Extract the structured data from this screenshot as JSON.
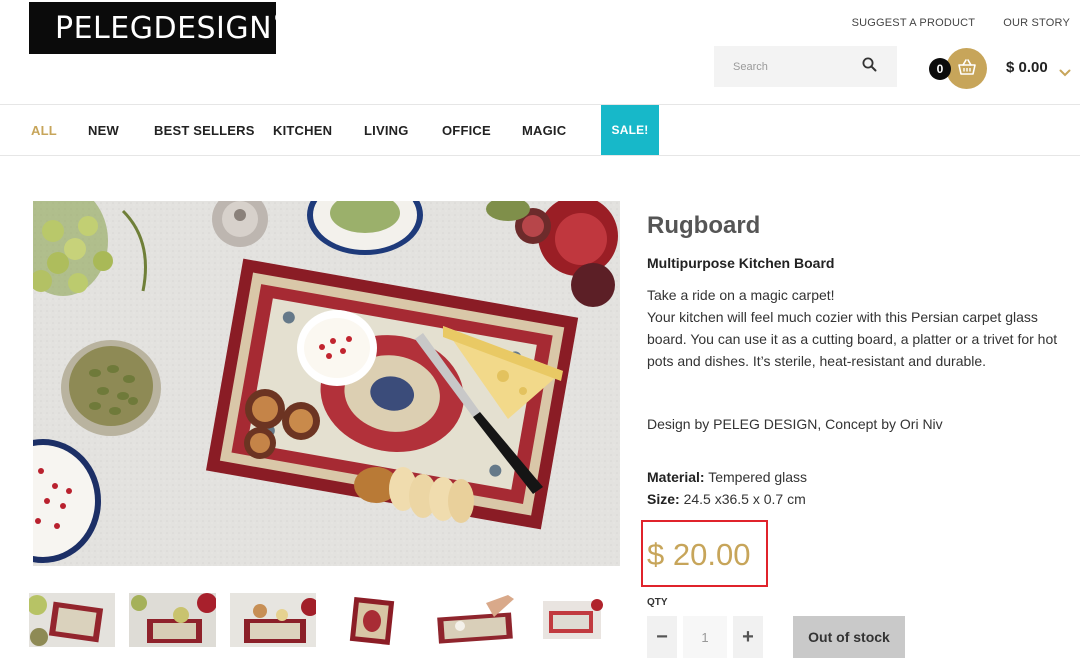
{
  "header": {
    "logo_text": "PELEGDESIGN",
    "logo_mark": "®",
    "top_links": [
      "SUGGEST A PRODUCT",
      "OUR STORY"
    ],
    "search_placeholder": "Search",
    "cart_count": "0",
    "cart_total": "$ 0.00"
  },
  "nav": {
    "items": [
      {
        "label": "ALL",
        "active": true
      },
      {
        "label": "NEW"
      },
      {
        "label": "BEST SELLERS"
      },
      {
        "label": "KITCHEN"
      },
      {
        "label": "LIVING"
      },
      {
        "label": "OFFICE"
      },
      {
        "label": "MAGIC"
      },
      {
        "label": "SALE!"
      }
    ]
  },
  "product": {
    "title": "Rugboard",
    "subtitle": "Multipurpose Kitchen Board",
    "description": [
      "Take a ride on a magic carpet!",
      "Your kitchen will feel much cozier with this Persian carpet glass board. You can use it as a cutting board, a platter or a trivet for hot pots and dishes. It’s sterile, heat-resistant and durable."
    ],
    "credit": "Design by PELEG DESIGN, Concept by Ori Niv",
    "material_label": "Material:",
    "material_value": "Tempered glass",
    "size_label": "Size:",
    "size_value": "24.5 x36.5 x 0.7 cm",
    "price": "$ 20.00",
    "qty_label": "QTY",
    "qty_minus": "−",
    "qty_value": "1",
    "qty_plus": "+",
    "stock_button": "Out of stock"
  },
  "colors": {
    "accent_gold": "#c7a55a",
    "sale_teal": "#17b8c9",
    "highlight_red": "#e0232b",
    "logo_bg": "#0b0b0b"
  },
  "icons": [
    "search-icon",
    "basket-icon",
    "chevron-down-icon"
  ]
}
